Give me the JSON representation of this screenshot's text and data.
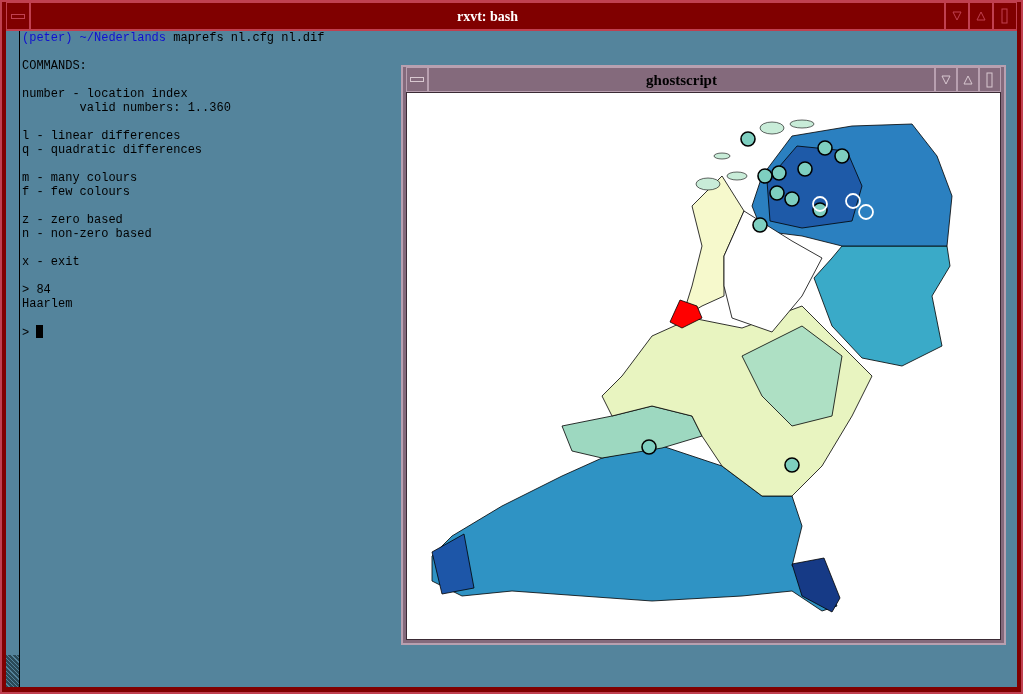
{
  "window": {
    "title": "rxvt: bash"
  },
  "terminal": {
    "prompt": "(peter) ~/Nederlands",
    "command": "maprefs nl.cfg nl.dif",
    "blocks": [
      [
        "COMMANDS:"
      ],
      [
        "number - location index",
        "        valid numbers: 1..360"
      ],
      [
        "l - linear differences",
        "q - quadratic differences"
      ],
      [
        "m - many colours",
        "f - few colours"
      ],
      [
        "z - zero based",
        "n - non-zero based"
      ],
      [
        "x - exit"
      ],
      [
        "> 84",
        "Haarlem"
      ]
    ],
    "input_prompt": ">"
  },
  "viewer": {
    "title": "ghostscript"
  }
}
